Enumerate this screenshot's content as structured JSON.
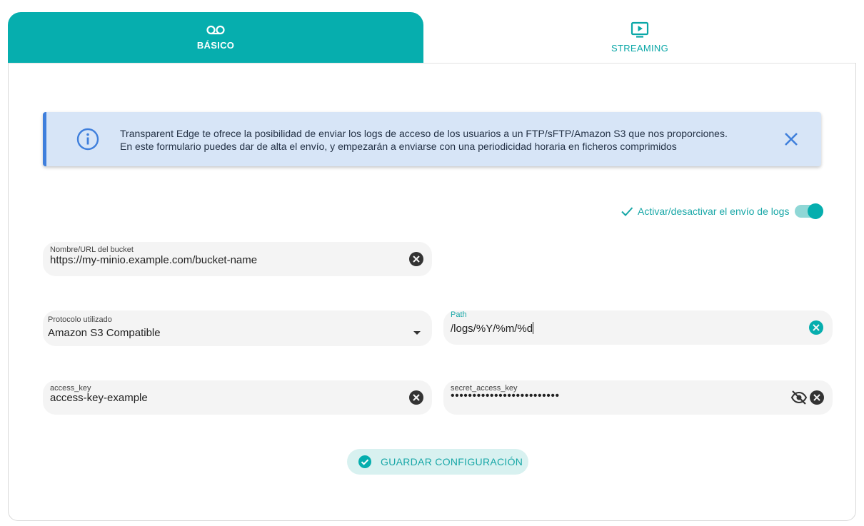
{
  "tabs": [
    {
      "label": "BÁSICO",
      "icon": "voicemail-icon",
      "active": true
    },
    {
      "label": "STREAMING",
      "icon": "tv-play-icon",
      "active": false
    }
  ],
  "alert": {
    "line1": "Transparent Edge te ofrece la posibilidad de enviar los logs de acceso de los usuarios a un FTP/sFTP/Amazon S3 que nos proporciones.",
    "line2": "En este formulario puedes dar de alta el envío, y empezarán a enviarse con una periodicidad horaria en ficheros comprimidos",
    "icon": "info-icon"
  },
  "toggle": {
    "label": "Activar/desactivar el envío de logs",
    "enabled": true
  },
  "form": {
    "bucket": {
      "label": "Nombre/URL del bucket",
      "value": "https://my-minio.example.com/bucket-name"
    },
    "protocol": {
      "label": "Protocolo utilizado",
      "value": "Amazon S3 Compatible"
    },
    "path": {
      "label": "Path",
      "value": "/logs/%Y/%m/%d"
    },
    "access_key": {
      "label": "access_key",
      "value": "access-key-example"
    },
    "secret_access_key": {
      "label": "secret_access_key",
      "value": "•••••••••••••••••••••••••"
    }
  },
  "save_button": {
    "label": "GUARDAR CONFIGURACIÓN"
  },
  "colors": {
    "accent": "#06aeae",
    "alert_bg": "#d7e5f7",
    "alert_border": "#3f7fdc"
  }
}
